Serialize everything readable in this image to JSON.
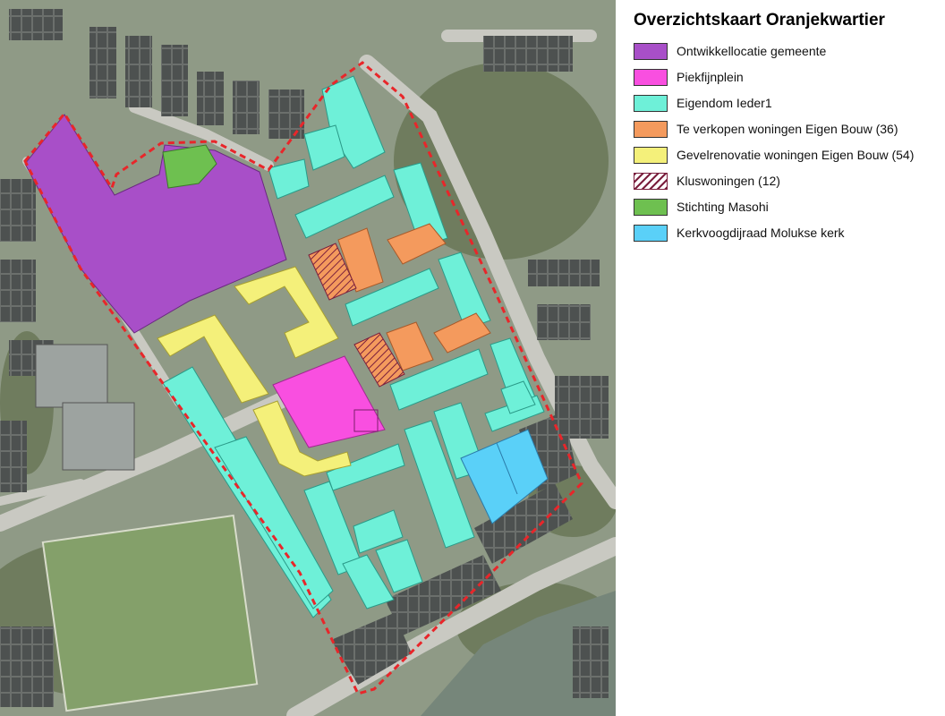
{
  "legend": {
    "title": "Overzichtskaart Oranjekwartier",
    "items": [
      {
        "label": "Ontwikkellocatie gemeente",
        "color": "#a84fc8",
        "icon": "purple-swatch"
      },
      {
        "label": "Piekfijnplein",
        "color": "#f94fe0",
        "icon": "magenta-swatch"
      },
      {
        "label": "Eigendom Ieder1",
        "color": "#6ef0d8",
        "icon": "teal-swatch"
      },
      {
        "label": "Te verkopen woningen Eigen Bouw (36)",
        "color": "#f49a5d",
        "icon": "orange-swatch"
      },
      {
        "label": "Gevelrenovatie woningen Eigen Bouw (54)",
        "color": "#f4f07a",
        "icon": "yellow-swatch"
      },
      {
        "label": "Kluswoningen (12)",
        "color": "#7a1f3d",
        "icon": "hatched-swatch",
        "pattern": "hatched"
      },
      {
        "label": "Stichting Masohi",
        "color": "#6ec050",
        "icon": "green-swatch"
      },
      {
        "label": "Kerkvoogdijraad Molukse kerk",
        "color": "#5ad0f8",
        "icon": "blue-swatch"
      }
    ]
  },
  "map": {
    "boundary_color": "#e8262a",
    "aerial_background": "#8f9a86",
    "road_color": "#c9c9c2",
    "building_color": "#55595a"
  }
}
